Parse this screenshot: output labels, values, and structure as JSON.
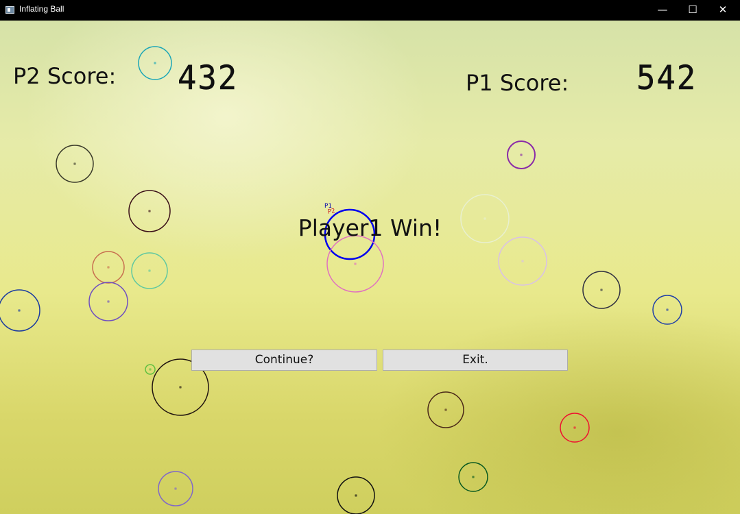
{
  "window": {
    "title": "Inflating Ball",
    "controls": {
      "minimize": "—",
      "maximize": "☐",
      "close": "✕"
    }
  },
  "scores": {
    "p2_label": "P2 Score:",
    "p2_value": "432",
    "p1_label": "P1 Score:",
    "p1_value": "542"
  },
  "result": {
    "message": "Player1 Win!"
  },
  "markers": {
    "p1": "P1",
    "p2": "P2"
  },
  "buttons": {
    "continue": "Continue?",
    "exit": "Exit."
  },
  "ball_colors": [
    "#1aa6b7",
    "#3a3a2a",
    "#8a2aa8",
    "#3a0f18",
    "#e8f0d0",
    "#0000ee",
    "#e070c0",
    "#d9c0e8",
    "#c87050",
    "#60c8a0",
    "#7050c0",
    "#1a3aa0",
    "#303040",
    "#1f3fa8",
    "#60c040",
    "#201410",
    "#4a2818",
    "#ee1030",
    "#0a5a20",
    "#8068c8",
    "#101010"
  ]
}
